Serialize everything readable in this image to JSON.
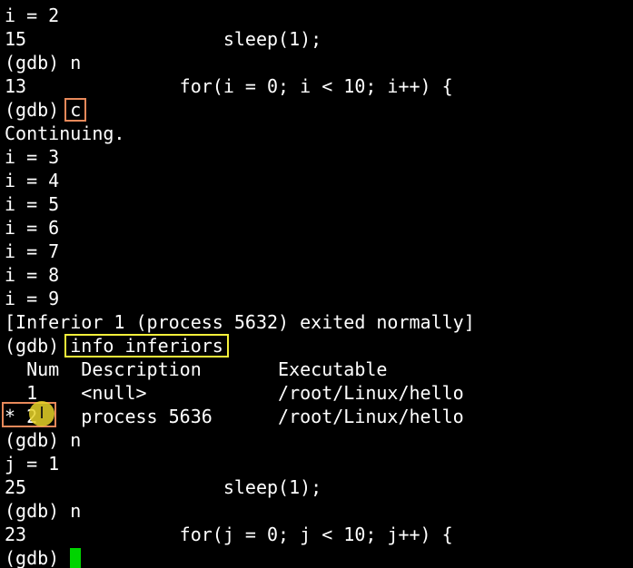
{
  "terminal": {
    "lines": [
      "i = 2",
      "15                  sleep(1);",
      "(gdb) n",
      "13              for(i = 0; i < 10; i++) {",
      {
        "prompt": "(gdb) ",
        "command": "c"
      },
      "Continuing.",
      "i = 3",
      "i = 4",
      "i = 5",
      "i = 6",
      "i = 7",
      "i = 8",
      "i = 9",
      "[Inferior 1 (process 5632) exited normally]",
      {
        "prompt": "(gdb) ",
        "command": "info inferiors"
      },
      "  Num  Description       Executable",
      "  1    <null>            /root/Linux/hello",
      "* 2    process 5636      /root/Linux/hello",
      "(gdb) n",
      "j = 1",
      "25                  sleep(1);",
      "(gdb) n",
      "23              for(j = 0; j < 10; j++) {",
      {
        "prompt": "(gdb) ",
        "cursor": true
      }
    ],
    "colors": {
      "background": "#000000",
      "text": "#ffffff",
      "cursor": "#00d400",
      "highlight_orange": "#e8895a",
      "highlight_yellow": "#f5f03a"
    },
    "mouse_cursor_icon": "i-beam-icon"
  }
}
